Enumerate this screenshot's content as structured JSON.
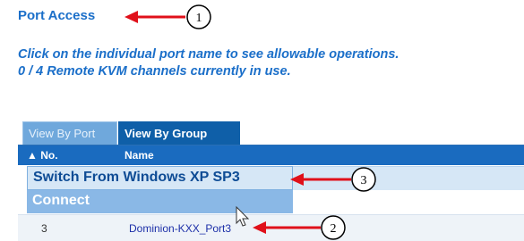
{
  "title": "Port Access",
  "instructions": {
    "line1": "Click on the individual port name to see allowable operations.",
    "line2": "0 / 4 Remote KVM channels currently in use."
  },
  "tabs": [
    {
      "label": "View By Port",
      "active": false
    },
    {
      "label": "View By Group",
      "active": true
    }
  ],
  "table": {
    "columns": {
      "no": "▲ No.",
      "name": "Name"
    },
    "rows": [
      {
        "no": "3",
        "name": "Dominion-KXX_Port3"
      }
    ]
  },
  "context_menu": {
    "items": [
      "Switch From Windows XP SP3",
      "Connect"
    ]
  },
  "callouts": [
    "1",
    "2",
    "3"
  ],
  "colors": {
    "title_blue": "#1b6fc9",
    "header_blue": "#1a6bbf",
    "arrow_red": "#e0101a"
  }
}
